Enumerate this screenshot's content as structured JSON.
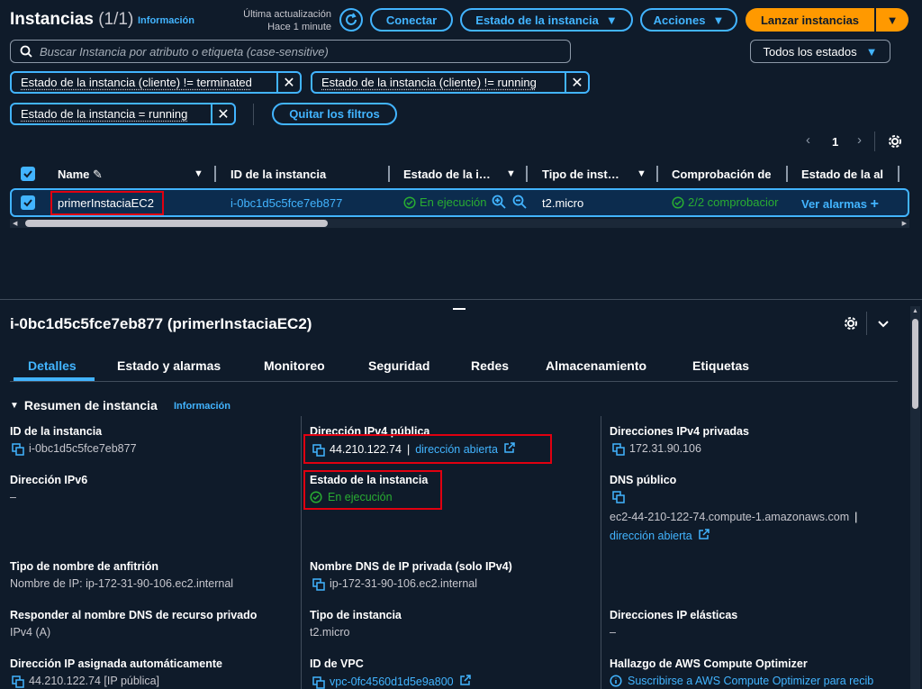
{
  "header": {
    "title": "Instancias",
    "count": "(1/1)",
    "info": "Información",
    "last_update_label": "Última actualización",
    "last_update_value": "Hace 1 minute",
    "connect": "Conectar",
    "instance_state": "Estado de la instancia",
    "actions": "Acciones",
    "launch": "Lanzar instancias"
  },
  "search": {
    "placeholder": "Buscar Instancia por atributo o etiqueta (case-sensitive)",
    "state_filter": "Todos los estados"
  },
  "filters": {
    "chips": [
      "Estado de la instancia (cliente) != terminated",
      "Estado de la instancia (cliente) != running",
      "Estado de la instancia = running"
    ],
    "clear": "Quitar los filtros"
  },
  "pagination": {
    "page": "1"
  },
  "table": {
    "columns": [
      "Name",
      "ID de la instancia",
      "Estado de la i…",
      "Tipo de inst…",
      "Comprobación de",
      "Estado de la al"
    ],
    "row": {
      "name": "primerInstaciaEC2",
      "id": "i-0bc1d5c5fce7eb877",
      "state": "En ejecución",
      "type": "t2.micro",
      "check": "2/2 comprobacior",
      "alarms": "Ver alarmas"
    }
  },
  "detail": {
    "title": "i-0bc1d5c5fce7eb877 (primerInstaciaEC2)",
    "tabs": [
      "Detalles",
      "Estado y alarmas",
      "Monitoreo",
      "Seguridad",
      "Redes",
      "Almacenamiento",
      "Etiquetas"
    ],
    "section": "Resumen de instancia",
    "section_info": "Información",
    "fields": {
      "instance_id_label": "ID de la instancia",
      "instance_id_value": "i-0bc1d5c5fce7eb877",
      "ipv4_public_label": "Dirección IPv4 pública",
      "ipv4_public_value": "44.210.122.74",
      "open_address": "dirección abierta",
      "ipv4_private_label": "Direcciones IPv4 privadas",
      "ipv4_private_value": "172.31.90.106",
      "ipv6_label": "Dirección IPv6",
      "ipv6_value": "–",
      "state_label": "Estado de la instancia",
      "state_value": "En ejecución",
      "public_dns_label": "DNS público",
      "public_dns_value": "ec2-44-210-122-74.compute-1.amazonaws.com",
      "public_dns_sep": "|",
      "public_dns_open": "dirección abierta",
      "hostname_type_label": "Tipo de nombre de anfitrión",
      "hostname_type_value": "Nombre de IP: ip-172-31-90-106.ec2.internal",
      "private_dns_label": "Nombre DNS de IP privada (solo IPv4)",
      "private_dns_value": "ip-172-31-90-106.ec2.internal",
      "answer_dns_label": "Responder al nombre DNS de recurso privado",
      "answer_dns_value": "IPv4 (A)",
      "instance_type_label": "Tipo de instancia",
      "instance_type_value": "t2.micro",
      "elastic_ip_label": "Direcciones IP elásticas",
      "elastic_ip_value": "–",
      "auto_ip_label": "Dirección IP asignada automáticamente",
      "auto_ip_value": "44.210.122.74 [IP pública]",
      "vpc_label": "ID de VPC",
      "vpc_value": "vpc-0fc4560d1d5e9a800",
      "optimizer_label": "Hallazgo de AWS Compute Optimizer",
      "optimizer_value": "Suscribirse a AWS Compute Optimizer para recib"
    }
  },
  "colors": {
    "background": "#0f1b2a",
    "link": "#42b4ff",
    "primary": "#ff9900",
    "success": "#29ad32",
    "highlight": "#e00010"
  }
}
